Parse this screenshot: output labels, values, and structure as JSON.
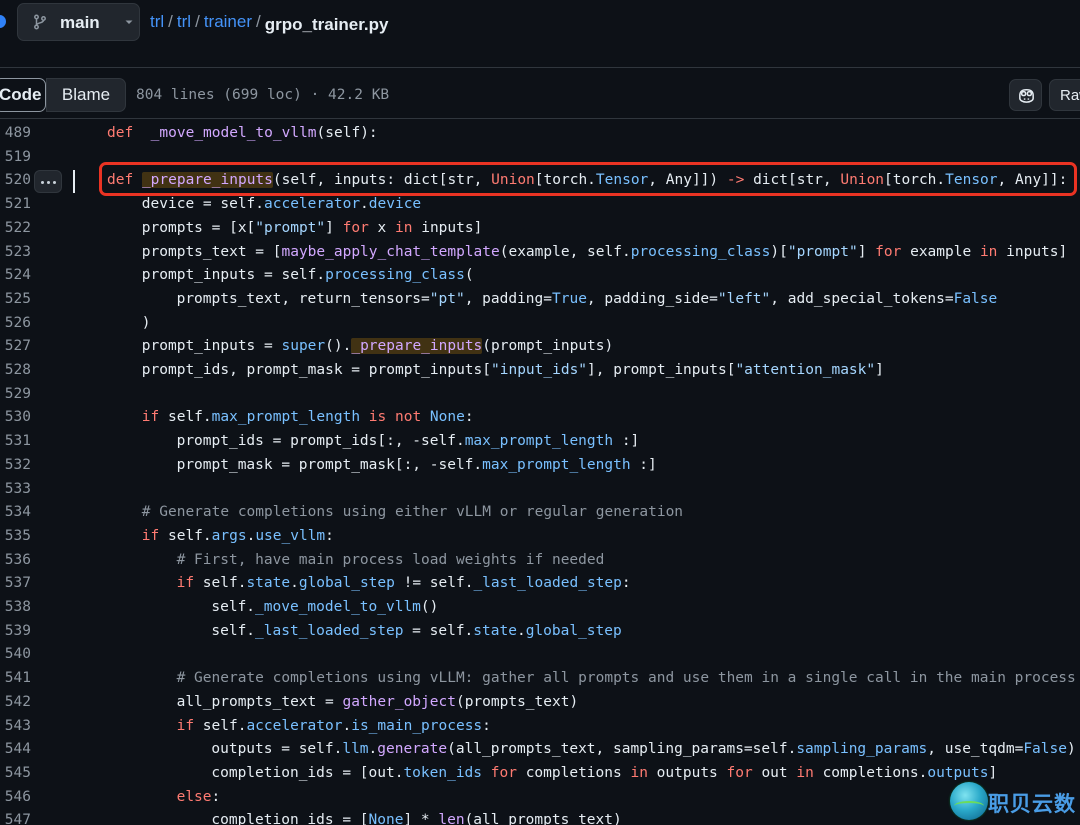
{
  "header": {
    "branch": "main",
    "breadcrumb": [
      "trl",
      "trl",
      "trainer"
    ],
    "breadcrumb_separator": "/",
    "file_name": "grpo_trainer.py"
  },
  "toolbar": {
    "code_tab": "Code",
    "blame_tab": "Blame",
    "file_stats": "804 lines (699 loc) · 42.2 KB",
    "raw_label": "Raw"
  },
  "icons": {
    "branch": "git-branch-icon",
    "caret": "chevron-down-icon",
    "copilot": "copilot-icon",
    "more": "kebab-horizontal-icon"
  },
  "colors": {
    "background": "#0d1117",
    "highlight_box": "#ea3323",
    "link": "#4493f8",
    "keyword": "#ff7b72",
    "function": "#d2a8ff",
    "builtin": "#79c0ff",
    "string": "#a5d6ff",
    "comment": "#8d96a0"
  },
  "code": {
    "highlighted_line": "520",
    "lines": [
      {
        "n": "489",
        "indent": 0,
        "tokens": [
          [
            "kw",
            "def"
          ],
          [
            "",
            "  "
          ],
          [
            "fn",
            "_move_model_to_vllm"
          ],
          [
            "",
            "(self):"
          ]
        ]
      },
      {
        "n": "519",
        "indent": 0,
        "tokens": []
      },
      {
        "n": "520",
        "indent": 0,
        "tokens": [
          [
            "kw",
            "def"
          ],
          [
            "",
            " "
          ],
          [
            "fnhl",
            "_prepare_inputs"
          ],
          [
            "",
            "(self, inputs: dict[str, "
          ],
          [
            "kw",
            "Union"
          ],
          [
            "",
            "[torch."
          ],
          [
            "bi",
            "Tensor"
          ],
          [
            "",
            ", Any]]) "
          ],
          [
            "kw",
            "->"
          ],
          [
            "",
            " dict[str, "
          ],
          [
            "kw",
            "Union"
          ],
          [
            "",
            "[torch."
          ],
          [
            "bi",
            "Tensor"
          ],
          [
            "",
            ", Any]]:"
          ]
        ]
      },
      {
        "n": "521",
        "indent": 1,
        "tokens": [
          [
            "",
            "device = self."
          ],
          [
            "bi",
            "accelerator"
          ],
          [
            "",
            "."
          ],
          [
            "bi",
            "device"
          ]
        ]
      },
      {
        "n": "522",
        "indent": 1,
        "tokens": [
          [
            "",
            "prompts = [x["
          ],
          [
            "st",
            "\"prompt\""
          ],
          [
            "",
            "] "
          ],
          [
            "kw",
            "for"
          ],
          [
            "",
            " x "
          ],
          [
            "kw",
            "in"
          ],
          [
            "",
            " inputs]"
          ]
        ]
      },
      {
        "n": "523",
        "indent": 1,
        "tokens": [
          [
            "",
            "prompts_text = ["
          ],
          [
            "fn",
            "maybe_apply_chat_template"
          ],
          [
            "",
            "(example, self."
          ],
          [
            "bi",
            "processing_class"
          ],
          [
            "",
            ")["
          ],
          [
            "st",
            "\"prompt\""
          ],
          [
            "",
            "] "
          ],
          [
            "kw",
            "for"
          ],
          [
            "",
            " example "
          ],
          [
            "kw",
            "in"
          ],
          [
            "",
            " inputs]"
          ]
        ]
      },
      {
        "n": "524",
        "indent": 1,
        "tokens": [
          [
            "",
            "prompt_inputs = self."
          ],
          [
            "bi",
            "processing_class"
          ],
          [
            "",
            "("
          ]
        ]
      },
      {
        "n": "525",
        "indent": 2,
        "tokens": [
          [
            "",
            "prompts_text, return_tensors="
          ],
          [
            "st",
            "\"pt\""
          ],
          [
            "",
            ", padding="
          ],
          [
            "bi",
            "True"
          ],
          [
            "",
            ", padding_side="
          ],
          [
            "st",
            "\"left\""
          ],
          [
            "",
            ", add_special_tokens="
          ],
          [
            "bi",
            "False"
          ]
        ]
      },
      {
        "n": "526",
        "indent": 1,
        "tokens": [
          [
            "",
            ")"
          ]
        ]
      },
      {
        "n": "527",
        "indent": 1,
        "tokens": [
          [
            "",
            "prompt_inputs = "
          ],
          [
            "bi",
            "super"
          ],
          [
            "",
            "()."
          ],
          [
            "fnhl",
            "_prepare_inputs"
          ],
          [
            "",
            "(prompt_inputs)"
          ]
        ]
      },
      {
        "n": "528",
        "indent": 1,
        "tokens": [
          [
            "",
            "prompt_ids, prompt_mask = prompt_inputs["
          ],
          [
            "st",
            "\"input_ids\""
          ],
          [
            "",
            "], prompt_inputs["
          ],
          [
            "st",
            "\"attention_mask\""
          ],
          [
            "",
            "]"
          ]
        ]
      },
      {
        "n": "529",
        "indent": 0,
        "tokens": []
      },
      {
        "n": "530",
        "indent": 1,
        "tokens": [
          [
            "kw",
            "if"
          ],
          [
            "",
            " self."
          ],
          [
            "bi",
            "max_prompt_length"
          ],
          [
            "",
            " "
          ],
          [
            "kw",
            "is not"
          ],
          [
            "",
            " "
          ],
          [
            "bi",
            "None"
          ],
          [
            "",
            ":"
          ]
        ]
      },
      {
        "n": "531",
        "indent": 2,
        "tokens": [
          [
            "",
            "prompt_ids = prompt_ids[:, -self."
          ],
          [
            "bi",
            "max_prompt_length"
          ],
          [
            "",
            " :]"
          ]
        ]
      },
      {
        "n": "532",
        "indent": 2,
        "tokens": [
          [
            "",
            "prompt_mask = prompt_mask[:, -self."
          ],
          [
            "bi",
            "max_prompt_length"
          ],
          [
            "",
            " :]"
          ]
        ]
      },
      {
        "n": "533",
        "indent": 0,
        "tokens": []
      },
      {
        "n": "534",
        "indent": 1,
        "tokens": [
          [
            "cm",
            "# Generate completions using either vLLM or regular generation"
          ]
        ]
      },
      {
        "n": "535",
        "indent": 1,
        "tokens": [
          [
            "kw",
            "if"
          ],
          [
            "",
            " self."
          ],
          [
            "bi",
            "args"
          ],
          [
            "",
            "."
          ],
          [
            "bi",
            "use_vllm"
          ],
          [
            "",
            ":"
          ]
        ]
      },
      {
        "n": "536",
        "indent": 2,
        "tokens": [
          [
            "cm",
            "# First, have main process load weights if needed"
          ]
        ]
      },
      {
        "n": "537",
        "indent": 2,
        "tokens": [
          [
            "kw",
            "if"
          ],
          [
            "",
            " self."
          ],
          [
            "bi",
            "state"
          ],
          [
            "",
            "."
          ],
          [
            "bi",
            "global_step"
          ],
          [
            "",
            " != self."
          ],
          [
            "bi",
            "_last_loaded_step"
          ],
          [
            "",
            ":"
          ]
        ]
      },
      {
        "n": "538",
        "indent": 3,
        "tokens": [
          [
            "",
            "self."
          ],
          [
            "bi",
            "_move_model_to_vllm"
          ],
          [
            "",
            "()"
          ]
        ]
      },
      {
        "n": "539",
        "indent": 3,
        "tokens": [
          [
            "",
            "self."
          ],
          [
            "bi",
            "_last_loaded_step"
          ],
          [
            "",
            " = self."
          ],
          [
            "bi",
            "state"
          ],
          [
            "",
            "."
          ],
          [
            "bi",
            "global_step"
          ]
        ]
      },
      {
        "n": "540",
        "indent": 0,
        "tokens": []
      },
      {
        "n": "541",
        "indent": 2,
        "tokens": [
          [
            "cm",
            "# Generate completions using vLLM: gather all prompts and use them in a single call in the main process"
          ]
        ]
      },
      {
        "n": "542",
        "indent": 2,
        "tokens": [
          [
            "",
            "all_prompts_text = "
          ],
          [
            "fn",
            "gather_object"
          ],
          [
            "",
            "(prompts_text)"
          ]
        ]
      },
      {
        "n": "543",
        "indent": 2,
        "tokens": [
          [
            "kw",
            "if"
          ],
          [
            "",
            " self."
          ],
          [
            "bi",
            "accelerator"
          ],
          [
            "",
            "."
          ],
          [
            "bi",
            "is_main_process"
          ],
          [
            "",
            ":"
          ]
        ]
      },
      {
        "n": "544",
        "indent": 3,
        "tokens": [
          [
            "",
            "outputs = self."
          ],
          [
            "bi",
            "llm"
          ],
          [
            "",
            "."
          ],
          [
            "fn",
            "generate"
          ],
          [
            "",
            "(all_prompts_text, sampling_params=self."
          ],
          [
            "bi",
            "sampling_params"
          ],
          [
            "",
            ", use_tqdm="
          ],
          [
            "bi",
            "False"
          ],
          [
            "",
            ")"
          ]
        ]
      },
      {
        "n": "545",
        "indent": 3,
        "tokens": [
          [
            "",
            "completion_ids = [out."
          ],
          [
            "bi",
            "token_ids"
          ],
          [
            "",
            " "
          ],
          [
            "kw",
            "for"
          ],
          [
            "",
            " completions "
          ],
          [
            "kw",
            "in"
          ],
          [
            "",
            " outputs "
          ],
          [
            "kw",
            "for"
          ],
          [
            "",
            " out "
          ],
          [
            "kw",
            "in"
          ],
          [
            "",
            " completions."
          ],
          [
            "bi",
            "outputs"
          ],
          [
            "",
            "]"
          ]
        ]
      },
      {
        "n": "546",
        "indent": 2,
        "tokens": [
          [
            "kw",
            "else"
          ],
          [
            "",
            ":"
          ]
        ]
      },
      {
        "n": "547",
        "indent": 3,
        "tokens": [
          [
            "",
            "completion_ids = ["
          ],
          [
            "bi",
            "None"
          ],
          [
            "",
            "] * "
          ],
          [
            "fn",
            "len"
          ],
          [
            "",
            "(all_prompts_text)"
          ]
        ]
      }
    ]
  },
  "watermark": {
    "text": "职贝云数"
  }
}
